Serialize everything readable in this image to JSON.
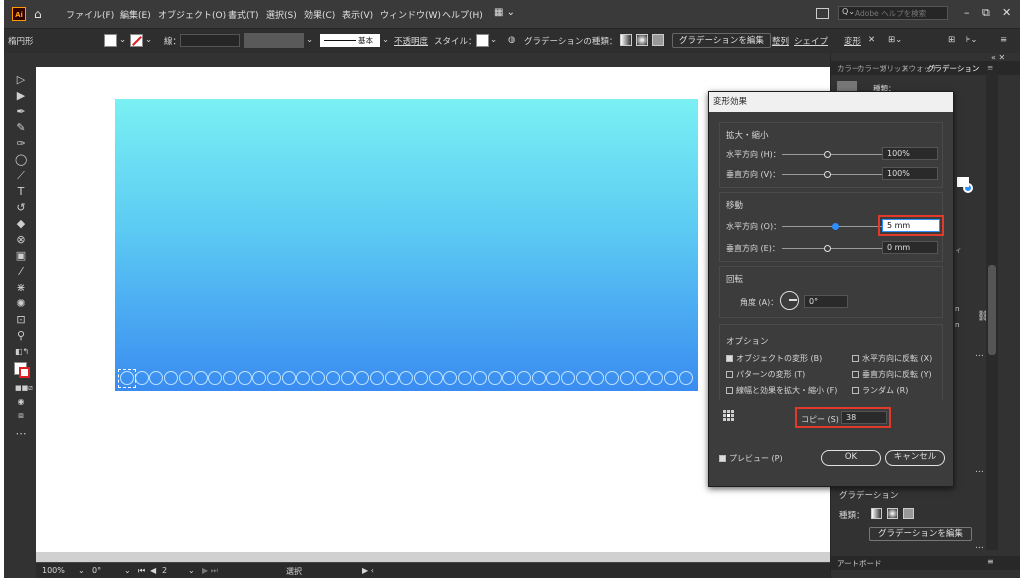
{
  "menubar": {
    "logo": "Ai",
    "items": [
      "ファイル(F)",
      "編集(E)",
      "オブジェクト(O)",
      "書式(T)",
      "選択(S)",
      "効果(C)",
      "表示(V)",
      "ウィンドウ(W)",
      "ヘルプ(H)"
    ],
    "search_placeholder": "Adobe ヘルプを検索"
  },
  "controlbar": {
    "shape_name": "楕円形",
    "stroke_label": "線：",
    "brush_label": "基本",
    "opacity_label": "不透明度",
    "style_label": "スタイル：",
    "gradient_type_label": "グラデーションの種類：",
    "edit_gradient_btn": "グラデーションを編集",
    "align_label": "整列",
    "shape_label": "シェイプ",
    "transform_label": "変形"
  },
  "panel": {
    "tabs": [
      "カラー",
      "カラーガ",
      "ソリッド",
      "スウォッチ",
      "グラデーション"
    ],
    "type_label": "種類：",
    "section_title": "グラデーション",
    "type_label2": "種類：",
    "edit_btn": "グラデーションを編集",
    "artboard_tab": "アートボード",
    "side_tab": "ィ"
  },
  "dialog": {
    "title": "変形効果",
    "scale_title": "拡大・縮小",
    "h_scale_label": "水平方向 (H)：",
    "h_scale_value": "100%",
    "v_scale_label": "垂直方向 (V)：",
    "v_scale_value": "100%",
    "move_title": "移動",
    "h_move_label": "水平方向 (O)：",
    "h_move_value": "5 mm",
    "v_move_label": "垂直方向 (E)：",
    "v_move_value": "0 mm",
    "rotate_title": "回転",
    "angle_label": "角度 (A)：",
    "angle_value": "0°",
    "options_title": "オプション",
    "opt_transform_objects": "オブジェクトの変形 (B)",
    "opt_transform_patterns": "パターンの変形 (T)",
    "opt_scale_strokes": "線幅と効果を拡大・縮小 (F)",
    "opt_reflect_x": "水平方向に反転 (X)",
    "opt_reflect_y": "垂直方向に反転 (Y)",
    "opt_random": "ランダム (R)",
    "copies_label": "コピー (S)",
    "copies_value": "38",
    "preview_label": "プレビュー (P)",
    "ok_label": "OK",
    "cancel_label": "キャンセル"
  },
  "statusbar": {
    "zoom": "100%",
    "rotation": "0°",
    "artboard": "2",
    "mode": "選択"
  },
  "colors": {
    "gradient_top": "#7af0f3",
    "gradient_bottom": "#3a8cf0",
    "highlight_red": "#e03a2a",
    "accent_blue": "#2e8fff"
  }
}
